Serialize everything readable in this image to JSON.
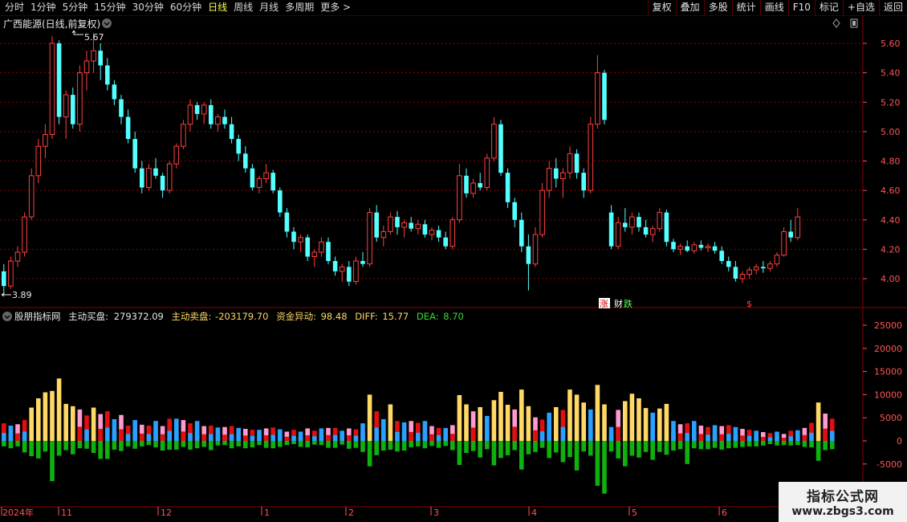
{
  "toolbar": {
    "periods": [
      "分时",
      "1分钟",
      "5分钟",
      "15分钟",
      "30分钟",
      "60分钟",
      "日线",
      "周线",
      "月线",
      "多周期",
      "更多 >"
    ],
    "active_period": "日线",
    "tools": [
      "复权",
      "叠加",
      "多股",
      "统计",
      "画线",
      "F10",
      "标记",
      "+自选",
      "返回"
    ]
  },
  "colors": {
    "up": "#ff4040",
    "down": "#54ffff",
    "grid": "#8b0000",
    "axis_text": "#ff5555",
    "white_text": "#e8e8e8",
    "buy_yellow": "#ffd866",
    "buy_red": "#e01010",
    "buy_blue": "#2aa0ff",
    "buy_pink": "#ff9ad0",
    "sell_green": "#10b010"
  },
  "main_panel": {
    "title": "广西能源(日线,前复权)",
    "high_label": "5.67",
    "low_label": "3.89",
    "price_ticks": [
      "5.60",
      "5.40",
      "5.20",
      "5.00",
      "4.80",
      "4.60",
      "4.40",
      "4.20",
      "4.00"
    ],
    "event_markers": [
      "涨",
      "财",
      "跌",
      "$"
    ]
  },
  "indicator_panel": {
    "name": "股朋指标网",
    "buy_label": "主动买盘:",
    "buy_value": "279372.09",
    "sell_label": "主动卖盘:",
    "sell_value": "-203179.70",
    "flow_label": "资金异动:",
    "flow_value": "98.48",
    "diff_label": "DIFF:",
    "diff_value": "15.77",
    "dea_label": "DEA:",
    "dea_value": "8.70",
    "ticks": [
      "25000",
      "20000",
      "15000",
      "10000",
      "5000",
      "0",
      "-5000"
    ]
  },
  "date_axis": [
    "2024年",
    "11",
    "12",
    "1",
    "2",
    "3",
    "4",
    "5",
    "6"
  ],
  "watermark": {
    "line1": "指标公式网",
    "line2": "www.zbgs3.com"
  },
  "chart_data": [
    {
      "type": "candlestick",
      "title": "广西能源(日线,前复权)",
      "ylim": [
        3.89,
        5.67
      ],
      "y_ticks": [
        4.0,
        4.2,
        4.4,
        4.6,
        4.8,
        5.0,
        5.2,
        5.4,
        5.6
      ],
      "series": [
        {
          "ohlc": [
            [
              4.05,
              4.1,
              3.89,
              3.95
            ],
            [
              3.95,
              4.15,
              3.93,
              4.12
            ],
            [
              4.12,
              4.22,
              4.08,
              4.18
            ],
            [
              4.18,
              4.45,
              4.15,
              4.42
            ],
            [
              4.42,
              4.75,
              4.4,
              4.7
            ],
            [
              4.7,
              4.95,
              4.65,
              4.9
            ],
            [
              4.9,
              5.05,
              4.82,
              4.98
            ],
            [
              4.98,
              5.65,
              4.95,
              5.6
            ],
            [
              5.6,
              5.62,
              5.05,
              5.1
            ],
            [
              5.1,
              5.28,
              4.95,
              5.25
            ],
            [
              5.25,
              5.3,
              5.02,
              5.05
            ],
            [
              5.05,
              5.45,
              5.0,
              5.4
            ],
            [
              5.4,
              5.55,
              5.28,
              5.48
            ],
            [
              5.48,
              5.67,
              5.4,
              5.55
            ],
            [
              5.55,
              5.6,
              5.35,
              5.45
            ],
            [
              5.45,
              5.5,
              5.28,
              5.32
            ],
            [
              5.32,
              5.35,
              5.18,
              5.22
            ],
            [
              5.22,
              5.25,
              5.05,
              5.1
            ],
            [
              5.1,
              5.15,
              4.92,
              4.95
            ],
            [
              4.95,
              5.0,
              4.72,
              4.75
            ],
            [
              4.75,
              4.8,
              4.58,
              4.62
            ],
            [
              4.62,
              4.78,
              4.6,
              4.75
            ],
            [
              4.75,
              4.82,
              4.68,
              4.7
            ],
            [
              4.7,
              4.72,
              4.55,
              4.6
            ],
            [
              4.6,
              4.8,
              4.58,
              4.78
            ],
            [
              4.78,
              4.92,
              4.75,
              4.9
            ],
            [
              4.9,
              5.08,
              4.88,
              5.05
            ],
            [
              5.05,
              5.22,
              5.0,
              5.18
            ],
            [
              5.18,
              5.2,
              5.08,
              5.12
            ],
            [
              5.12,
              5.2,
              5.05,
              5.18
            ],
            [
              5.18,
              5.22,
              5.02,
              5.05
            ],
            [
              5.05,
              5.12,
              5.0,
              5.1
            ],
            [
              5.1,
              5.15,
              5.02,
              5.05
            ],
            [
              5.05,
              5.1,
              4.92,
              4.95
            ],
            [
              4.95,
              4.98,
              4.8,
              4.85
            ],
            [
              4.85,
              4.9,
              4.72,
              4.75
            ],
            [
              4.75,
              4.78,
              4.6,
              4.62
            ],
            [
              4.62,
              4.7,
              4.58,
              4.68
            ],
            [
              4.68,
              4.78,
              4.65,
              4.72
            ],
            [
              4.72,
              4.74,
              4.58,
              4.6
            ],
            [
              4.6,
              4.62,
              4.42,
              4.45
            ],
            [
              4.45,
              4.48,
              4.28,
              4.32
            ],
            [
              4.32,
              4.35,
              4.2,
              4.25
            ],
            [
              4.25,
              4.3,
              4.18,
              4.28
            ],
            [
              4.28,
              4.3,
              4.12,
              4.15
            ],
            [
              4.15,
              4.2,
              4.08,
              4.18
            ],
            [
              4.18,
              4.28,
              4.15,
              4.25
            ],
            [
              4.25,
              4.28,
              4.1,
              4.12
            ],
            [
              4.12,
              4.15,
              4.02,
              4.05
            ],
            [
              4.05,
              4.1,
              3.98,
              4.08
            ],
            [
              4.08,
              4.12,
              3.95,
              3.98
            ],
            [
              3.98,
              4.15,
              3.96,
              4.12
            ],
            [
              4.12,
              4.18,
              4.08,
              4.1
            ],
            [
              4.1,
              4.48,
              4.08,
              4.45
            ],
            [
              4.45,
              4.5,
              4.25,
              4.28
            ],
            [
              4.28,
              4.36,
              4.22,
              4.32
            ],
            [
              4.32,
              4.45,
              4.3,
              4.42
            ],
            [
              4.42,
              4.46,
              4.3,
              4.35
            ],
            [
              4.35,
              4.4,
              4.28,
              4.38
            ],
            [
              4.38,
              4.42,
              4.32,
              4.34
            ],
            [
              4.34,
              4.4,
              4.3,
              4.37
            ],
            [
              4.37,
              4.4,
              4.28,
              4.3
            ],
            [
              4.3,
              4.35,
              4.26,
              4.33
            ],
            [
              4.33,
              4.36,
              4.25,
              4.28
            ],
            [
              4.28,
              4.32,
              4.2,
              4.22
            ],
            [
              4.22,
              4.42,
              4.2,
              4.4
            ],
            [
              4.4,
              4.78,
              4.38,
              4.7
            ],
            [
              4.7,
              4.75,
              4.55,
              4.58
            ],
            [
              4.58,
              4.68,
              4.55,
              4.65
            ],
            [
              4.65,
              4.72,
              4.6,
              4.62
            ],
            [
              4.62,
              4.85,
              4.6,
              4.82
            ],
            [
              4.82,
              5.1,
              4.8,
              5.05
            ],
            [
              5.05,
              5.08,
              4.7,
              4.72
            ],
            [
              4.72,
              4.75,
              4.48,
              4.52
            ],
            [
              4.52,
              4.55,
              4.35,
              4.4
            ],
            [
              4.4,
              4.45,
              4.18,
              4.22
            ],
            [
              4.22,
              4.3,
              3.92,
              4.1
            ],
            [
              4.1,
              4.35,
              4.08,
              4.3
            ],
            [
              4.3,
              4.65,
              4.28,
              4.6
            ],
            [
              4.6,
              4.8,
              4.55,
              4.75
            ],
            [
              4.75,
              4.82,
              4.62,
              4.68
            ],
            [
              4.68,
              4.75,
              4.55,
              4.72
            ],
            [
              4.72,
              4.9,
              4.68,
              4.85
            ],
            [
              4.85,
              4.88,
              4.68,
              4.72
            ],
            [
              4.72,
              4.75,
              4.55,
              4.6
            ],
            [
              4.6,
              5.1,
              4.58,
              5.05
            ],
            [
              5.05,
              5.52,
              5.02,
              5.4
            ],
            [
              5.4,
              5.42,
              5.05,
              5.08
            ],
            [
              4.45,
              4.5,
              4.2,
              4.22
            ],
            [
              4.22,
              4.42,
              4.2,
              4.38
            ],
            [
              4.38,
              4.48,
              4.32,
              4.35
            ],
            [
              4.35,
              4.45,
              4.3,
              4.42
            ],
            [
              4.42,
              4.45,
              4.32,
              4.35
            ],
            [
              4.35,
              4.4,
              4.28,
              4.3
            ],
            [
              4.3,
              4.36,
              4.25,
              4.34
            ],
            [
              4.34,
              4.48,
              4.32,
              4.45
            ],
            [
              4.45,
              4.47,
              4.22,
              4.25
            ],
            [
              4.25,
              4.27,
              4.18,
              4.2
            ],
            [
              4.2,
              4.24,
              4.16,
              4.22
            ],
            [
              4.22,
              4.26,
              4.18,
              4.19
            ],
            [
              4.19,
              4.25,
              4.17,
              4.23
            ],
            [
              4.23,
              4.26,
              4.19,
              4.21
            ],
            [
              4.21,
              4.24,
              4.18,
              4.22
            ],
            [
              4.22,
              4.25,
              4.17,
              4.19
            ],
            [
              4.19,
              4.22,
              4.1,
              4.12
            ],
            [
              4.12,
              4.15,
              4.05,
              4.08
            ],
            [
              4.08,
              4.12,
              3.98,
              4.0
            ],
            [
              4.0,
              4.05,
              3.97,
              4.03
            ],
            [
              4.03,
              4.08,
              4.0,
              4.06
            ],
            [
              4.06,
              4.1,
              4.03,
              4.08
            ],
            [
              4.08,
              4.12,
              4.04,
              4.07
            ],
            [
              4.07,
              4.12,
              4.05,
              4.1
            ],
            [
              4.1,
              4.18,
              4.08,
              4.16
            ],
            [
              4.16,
              4.35,
              4.15,
              4.32
            ],
            [
              4.32,
              4.4,
              4.25,
              4.28
            ],
            [
              4.28,
              4.48,
              4.26,
              4.42
            ]
          ]
        }
      ]
    },
    {
      "type": "bar",
      "title": "股朋指标网",
      "ylim": [
        -8000,
        26000
      ],
      "y_ticks": [
        -5000,
        0,
        5000,
        10000,
        15000,
        20000,
        25000
      ],
      "series": [
        {
          "name": "主动买盘",
          "values": [
            3800,
            3300,
            3600,
            4500,
            7200,
            9200,
            10500,
            10800,
            13500,
            8000,
            7500,
            6800,
            5500,
            7200,
            5800,
            6400,
            4700,
            5600,
            3300,
            4500,
            3500,
            3300,
            4300,
            3200,
            4800,
            4800,
            4500,
            3800,
            4300,
            3200,
            3300,
            2900,
            3000,
            3200,
            2800,
            2600,
            2400,
            2400,
            2700,
            2900,
            2500,
            2000,
            2400,
            2000,
            2700,
            2200,
            2700,
            2800,
            2800,
            2200,
            2700,
            2500,
            3800,
            10000,
            6400,
            4700,
            7900,
            4300,
            4000,
            4300,
            3900,
            4300,
            3200,
            2800,
            2800,
            3400,
            9900,
            7900,
            6400,
            7300,
            5400,
            8800,
            10600,
            7800,
            6800,
            11100,
            7500,
            5100,
            4600,
            6100,
            7300,
            6700,
            11100,
            10000,
            8300,
            6800,
            12100,
            7900,
            3000,
            6700,
            8600,
            10200,
            9200,
            7100,
            6100,
            7000,
            8000,
            4300,
            3600,
            3800,
            4300,
            3300,
            3000,
            3400,
            3200,
            3400,
            3000,
            2600,
            2400,
            2200,
            1900,
            1700,
            2000,
            1500,
            2200,
            2300,
            2800,
            3900,
            8300,
            5900,
            4800
          ]
        },
        {
          "name": "主动卖盘",
          "values": [
            -1200,
            -1600,
            -1200,
            -2500,
            -3300,
            -3800,
            -2300,
            -8700,
            -3200,
            -2000,
            -2900,
            -1600,
            -1700,
            -2600,
            -3900,
            -3900,
            -1900,
            -2200,
            -1200,
            -1700,
            -1200,
            -900,
            -1400,
            -2100,
            -1900,
            -1900,
            -1300,
            -1900,
            -1600,
            -1300,
            -2000,
            -1000,
            -900,
            -1600,
            -1200,
            -1600,
            -1400,
            -900,
            -1500,
            -1600,
            -1300,
            -900,
            -700,
            -1300,
            -1400,
            -800,
            -900,
            -1500,
            -1500,
            -800,
            -1700,
            -1500,
            -2400,
            -5500,
            -3100,
            -2100,
            -1900,
            -2300,
            -2100,
            -1400,
            -1200,
            -1600,
            -1100,
            -1500,
            -1100,
            -2000,
            -5200,
            -2600,
            -2200,
            -3600,
            -1800,
            -5300,
            -3700,
            -3100,
            -2000,
            -6200,
            -2900,
            -2400,
            -1500,
            -3700,
            -2500,
            -4600,
            -3500,
            -6400,
            -2300,
            -3200,
            -9700,
            -11400,
            -2300,
            -3800,
            -5500,
            -3200,
            -3600,
            -2400,
            -4100,
            -2400,
            -3000,
            -2100,
            -1800,
            -5000,
            -1600,
            -1800,
            -1800,
            -1500,
            -1900,
            -1600,
            -1500,
            -1300,
            -1200,
            -1200,
            -1000,
            -700,
            -1000,
            -900,
            -1000,
            -900,
            -1300,
            -1400,
            -4300,
            -2000,
            -1800
          ]
        }
      ]
    }
  ]
}
